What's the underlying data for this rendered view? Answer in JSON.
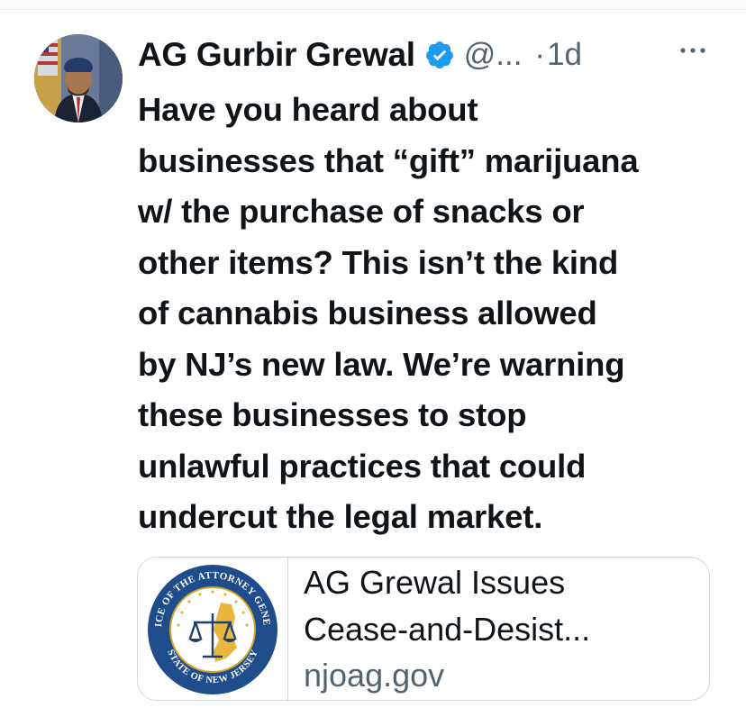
{
  "tweet": {
    "author_name": "AG Gurbir Grewal",
    "handle": "@...",
    "separator": "·",
    "time": "1d",
    "more_icon": "more-horizontal-icon",
    "verified_icon": "verified-badge-icon",
    "text_lines": [
      "Have you heard about",
      "businesses that “gift” marijuana",
      "w/ the purchase of snacks or",
      "other items? This isn’t the kind",
      "of cannabis business allowed",
      "by NJ’s new law. We’re warning",
      "these businesses to stop",
      "unlawful practices that could",
      "undercut the legal market."
    ]
  },
  "link_card": {
    "title_lines": [
      "AG Grewal Issues",
      "Cease-and-Desist..."
    ],
    "domain": "njoag.gov",
    "seal": {
      "top_text": "OFFICE OF THE ATTORNEY GENERAL",
      "bottom_text": "STATE OF NEW JERSEY"
    }
  },
  "colors": {
    "text": "#0f1419",
    "muted": "#536471",
    "verified": "#1d9bf0",
    "card_border": "#cfd9de"
  }
}
